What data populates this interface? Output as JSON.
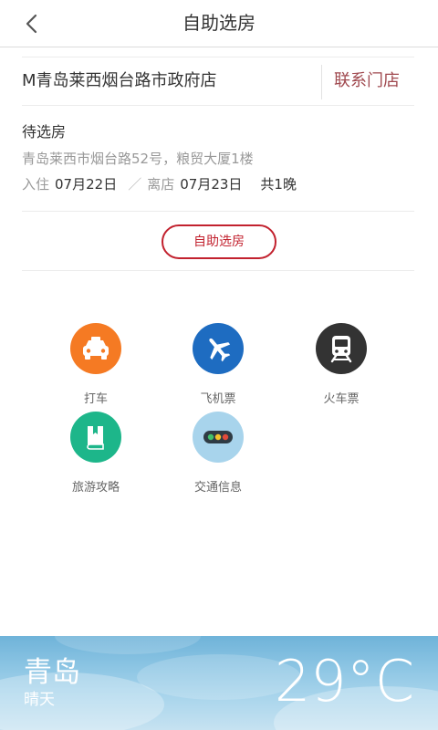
{
  "header": {
    "title": "自助选房"
  },
  "hotel": {
    "name": "M青岛莱西烟台路市政府店",
    "contact_label": "联系门店",
    "status": "待选房",
    "address": "青岛莱西市烟台路52号，粮贸大厦1楼",
    "checkin_label": "入住",
    "checkin_date": "07月22日",
    "separator": "／",
    "checkout_label": "离店",
    "checkout_date": "07月23日",
    "nights": "共1晚"
  },
  "actions": {
    "select_room_label": "自助选房"
  },
  "services": [
    {
      "label": "打车",
      "icon": "taxi-icon",
      "color": "#f57a23"
    },
    {
      "label": "飞机票",
      "icon": "airplane-icon",
      "color": "#1e6cc1"
    },
    {
      "label": "火车票",
      "icon": "train-icon",
      "color": "#333333"
    },
    {
      "label": "旅游攻略",
      "icon": "guide-book-icon",
      "color": "#1db68a"
    },
    {
      "label": "交通信息",
      "icon": "traffic-light-icon",
      "color": "#a8d4ec"
    }
  ],
  "weather": {
    "city": "青岛",
    "condition": "晴天",
    "temperature": "29°C"
  }
}
